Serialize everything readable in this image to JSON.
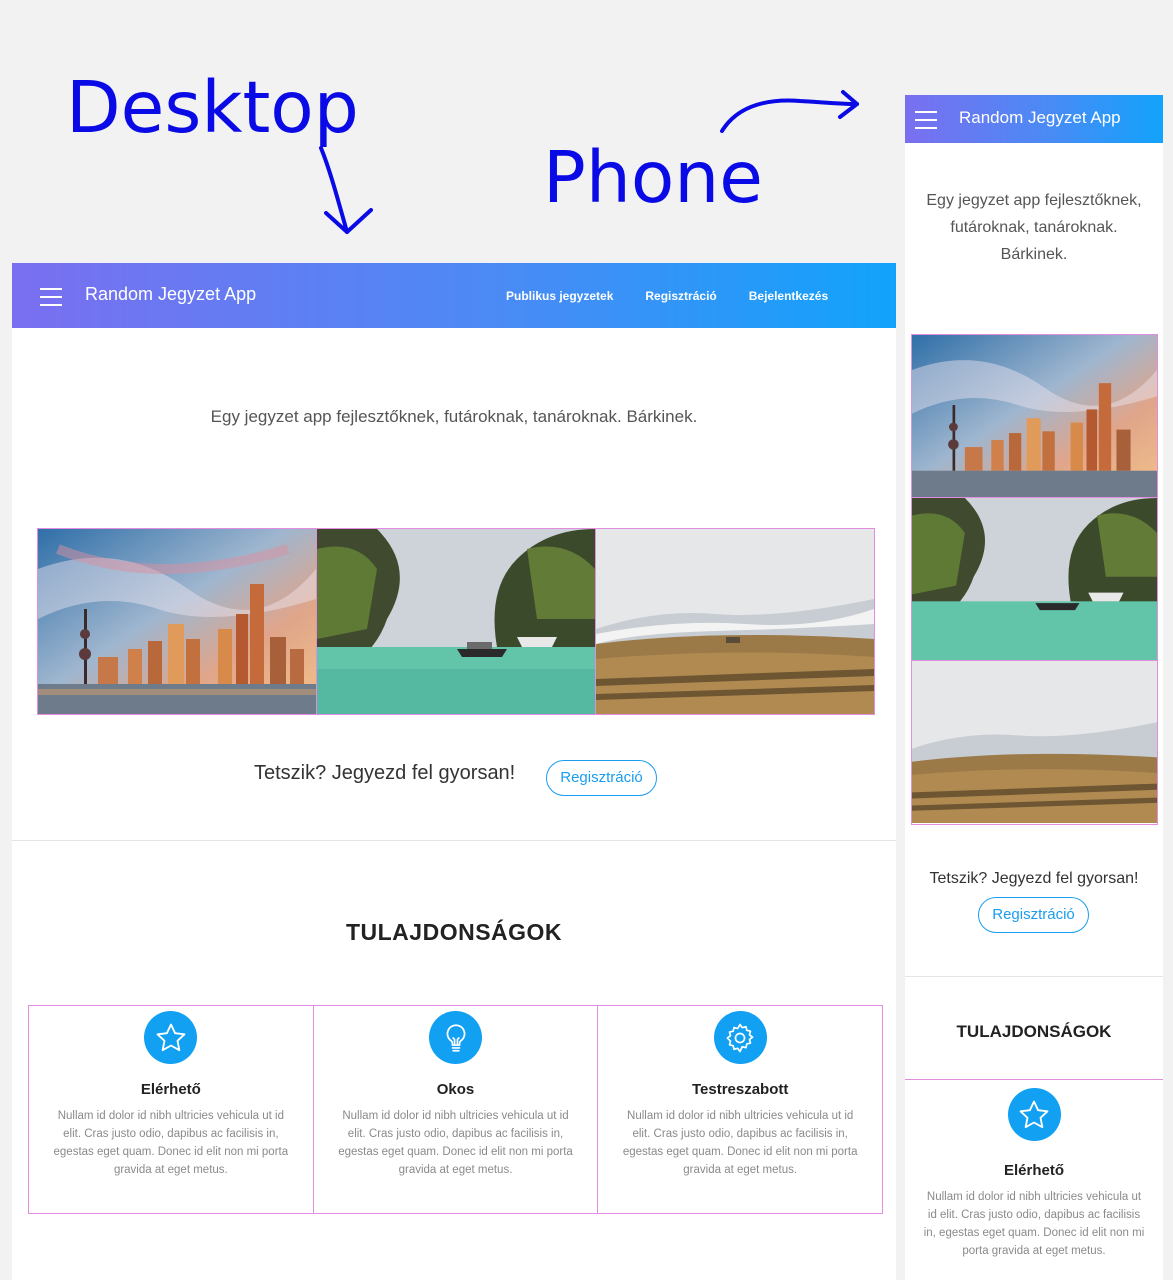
{
  "annotations": {
    "desktop": "Desktop",
    "phone": "Phone"
  },
  "app": {
    "brand": "Random Jegyzet App",
    "nav_links": [
      "Publikus jegyzetek",
      "Regisztráció",
      "Bejelentkezés"
    ],
    "tagline": "Egy jegyzet app fejlesztőknek, futároknak, tanároknak. Bárkinek.",
    "cta_text": "Tetszik? Jegyezd fel gyorsan!",
    "cta_button": "Regisztráció",
    "features_title": "TULAJDONSÁGOK",
    "features": [
      {
        "icon": "star-icon",
        "title": "Elérhető",
        "text": "Nullam id dolor id nibh ultricies vehicula ut id elit. Cras justo odio, dapibus ac facilisis in, egestas eget quam. Donec id elit non mi porta gravida at eget metus."
      },
      {
        "icon": "lightbulb-icon",
        "title": "Okos",
        "text": "Nullam id dolor id nibh ultricies vehicula ut id elit. Cras justo odio, dapibus ac facilisis in, egestas eget quam. Donec id elit non mi porta gravida at eget metus."
      },
      {
        "icon": "gear-icon",
        "title": "Testreszabott",
        "text": "Nullam id dolor id nibh ultricies vehicula ut id elit. Cras justo odio, dapibus ac facilisis in, egestas eget quam. Donec id elit non mi porta gravida at eget metus."
      }
    ]
  },
  "images": [
    "city-skyline",
    "tropical-bay",
    "hills-landscape"
  ],
  "colors": {
    "accent": "#12a0f2",
    "nav_start": "#7a6ff0",
    "nav_end": "#11a3fb",
    "annotation": "#0a0ae6",
    "grid_border": "#e28de0"
  }
}
